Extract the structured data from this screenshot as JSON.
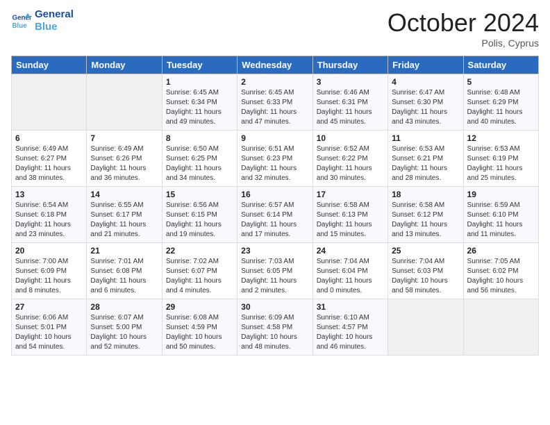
{
  "header": {
    "logo_line1": "General",
    "logo_line2": "Blue",
    "month_title": "October 2024",
    "subtitle": "Polis, Cyprus"
  },
  "days_of_week": [
    "Sunday",
    "Monday",
    "Tuesday",
    "Wednesday",
    "Thursday",
    "Friday",
    "Saturday"
  ],
  "weeks": [
    [
      {
        "day": "",
        "info": ""
      },
      {
        "day": "",
        "info": ""
      },
      {
        "day": "1",
        "info": "Sunrise: 6:45 AM\nSunset: 6:34 PM\nDaylight: 11 hours and 49 minutes."
      },
      {
        "day": "2",
        "info": "Sunrise: 6:45 AM\nSunset: 6:33 PM\nDaylight: 11 hours and 47 minutes."
      },
      {
        "day": "3",
        "info": "Sunrise: 6:46 AM\nSunset: 6:31 PM\nDaylight: 11 hours and 45 minutes."
      },
      {
        "day": "4",
        "info": "Sunrise: 6:47 AM\nSunset: 6:30 PM\nDaylight: 11 hours and 43 minutes."
      },
      {
        "day": "5",
        "info": "Sunrise: 6:48 AM\nSunset: 6:29 PM\nDaylight: 11 hours and 40 minutes."
      }
    ],
    [
      {
        "day": "6",
        "info": "Sunrise: 6:49 AM\nSunset: 6:27 PM\nDaylight: 11 hours and 38 minutes."
      },
      {
        "day": "7",
        "info": "Sunrise: 6:49 AM\nSunset: 6:26 PM\nDaylight: 11 hours and 36 minutes."
      },
      {
        "day": "8",
        "info": "Sunrise: 6:50 AM\nSunset: 6:25 PM\nDaylight: 11 hours and 34 minutes."
      },
      {
        "day": "9",
        "info": "Sunrise: 6:51 AM\nSunset: 6:23 PM\nDaylight: 11 hours and 32 minutes."
      },
      {
        "day": "10",
        "info": "Sunrise: 6:52 AM\nSunset: 6:22 PM\nDaylight: 11 hours and 30 minutes."
      },
      {
        "day": "11",
        "info": "Sunrise: 6:53 AM\nSunset: 6:21 PM\nDaylight: 11 hours and 28 minutes."
      },
      {
        "day": "12",
        "info": "Sunrise: 6:53 AM\nSunset: 6:19 PM\nDaylight: 11 hours and 25 minutes."
      }
    ],
    [
      {
        "day": "13",
        "info": "Sunrise: 6:54 AM\nSunset: 6:18 PM\nDaylight: 11 hours and 23 minutes."
      },
      {
        "day": "14",
        "info": "Sunrise: 6:55 AM\nSunset: 6:17 PM\nDaylight: 11 hours and 21 minutes."
      },
      {
        "day": "15",
        "info": "Sunrise: 6:56 AM\nSunset: 6:15 PM\nDaylight: 11 hours and 19 minutes."
      },
      {
        "day": "16",
        "info": "Sunrise: 6:57 AM\nSunset: 6:14 PM\nDaylight: 11 hours and 17 minutes."
      },
      {
        "day": "17",
        "info": "Sunrise: 6:58 AM\nSunset: 6:13 PM\nDaylight: 11 hours and 15 minutes."
      },
      {
        "day": "18",
        "info": "Sunrise: 6:58 AM\nSunset: 6:12 PM\nDaylight: 11 hours and 13 minutes."
      },
      {
        "day": "19",
        "info": "Sunrise: 6:59 AM\nSunset: 6:10 PM\nDaylight: 11 hours and 11 minutes."
      }
    ],
    [
      {
        "day": "20",
        "info": "Sunrise: 7:00 AM\nSunset: 6:09 PM\nDaylight: 11 hours and 8 minutes."
      },
      {
        "day": "21",
        "info": "Sunrise: 7:01 AM\nSunset: 6:08 PM\nDaylight: 11 hours and 6 minutes."
      },
      {
        "day": "22",
        "info": "Sunrise: 7:02 AM\nSunset: 6:07 PM\nDaylight: 11 hours and 4 minutes."
      },
      {
        "day": "23",
        "info": "Sunrise: 7:03 AM\nSunset: 6:05 PM\nDaylight: 11 hours and 2 minutes."
      },
      {
        "day": "24",
        "info": "Sunrise: 7:04 AM\nSunset: 6:04 PM\nDaylight: 11 hours and 0 minutes."
      },
      {
        "day": "25",
        "info": "Sunrise: 7:04 AM\nSunset: 6:03 PM\nDaylight: 10 hours and 58 minutes."
      },
      {
        "day": "26",
        "info": "Sunrise: 7:05 AM\nSunset: 6:02 PM\nDaylight: 10 hours and 56 minutes."
      }
    ],
    [
      {
        "day": "27",
        "info": "Sunrise: 6:06 AM\nSunset: 5:01 PM\nDaylight: 10 hours and 54 minutes."
      },
      {
        "day": "28",
        "info": "Sunrise: 6:07 AM\nSunset: 5:00 PM\nDaylight: 10 hours and 52 minutes."
      },
      {
        "day": "29",
        "info": "Sunrise: 6:08 AM\nSunset: 4:59 PM\nDaylight: 10 hours and 50 minutes."
      },
      {
        "day": "30",
        "info": "Sunrise: 6:09 AM\nSunset: 4:58 PM\nDaylight: 10 hours and 48 minutes."
      },
      {
        "day": "31",
        "info": "Sunrise: 6:10 AM\nSunset: 4:57 PM\nDaylight: 10 hours and 46 minutes."
      },
      {
        "day": "",
        "info": ""
      },
      {
        "day": "",
        "info": ""
      }
    ]
  ]
}
